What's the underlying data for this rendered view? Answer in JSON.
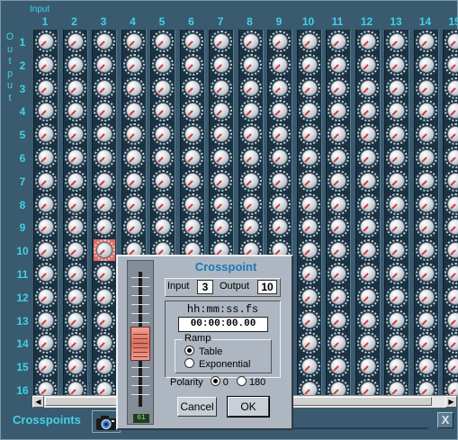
{
  "window": {
    "input_axis_label": "Input",
    "output_axis_label": "Output",
    "footer_title": "Crosspoints",
    "close_label": "X",
    "accent_color": "#3fd3e6"
  },
  "matrix": {
    "columns": [
      "1",
      "2",
      "3",
      "4",
      "5",
      "6",
      "7",
      "8",
      "9",
      "10",
      "11",
      "12",
      "13",
      "14",
      "15"
    ],
    "rows": [
      "1",
      "2",
      "3",
      "4",
      "5",
      "6",
      "7",
      "8",
      "9",
      "10",
      "11",
      "12",
      "13",
      "14",
      "15",
      "16"
    ],
    "selected": {
      "input": 3,
      "output": 10
    },
    "scroll": {
      "left_arrow": "◀",
      "right_arrow": "▶"
    }
  },
  "dialog": {
    "title": "Crosspoint",
    "input_label": "Input",
    "input_value": "3",
    "output_label": "Output",
    "output_value": "10",
    "time_format_label": "hh:mm:ss.fs",
    "time_value": "00:00:00.00",
    "ramp_label": "Ramp",
    "ramp_options": [
      "Table",
      "Exponential"
    ],
    "ramp_selected": "Table",
    "polarity_label": "Polarity",
    "polarity_options": [
      "0",
      "180"
    ],
    "polarity_selected": "0",
    "cancel_label": "Cancel",
    "ok_label": "OK",
    "fader_value": "61",
    "fader_level": 0.61
  }
}
